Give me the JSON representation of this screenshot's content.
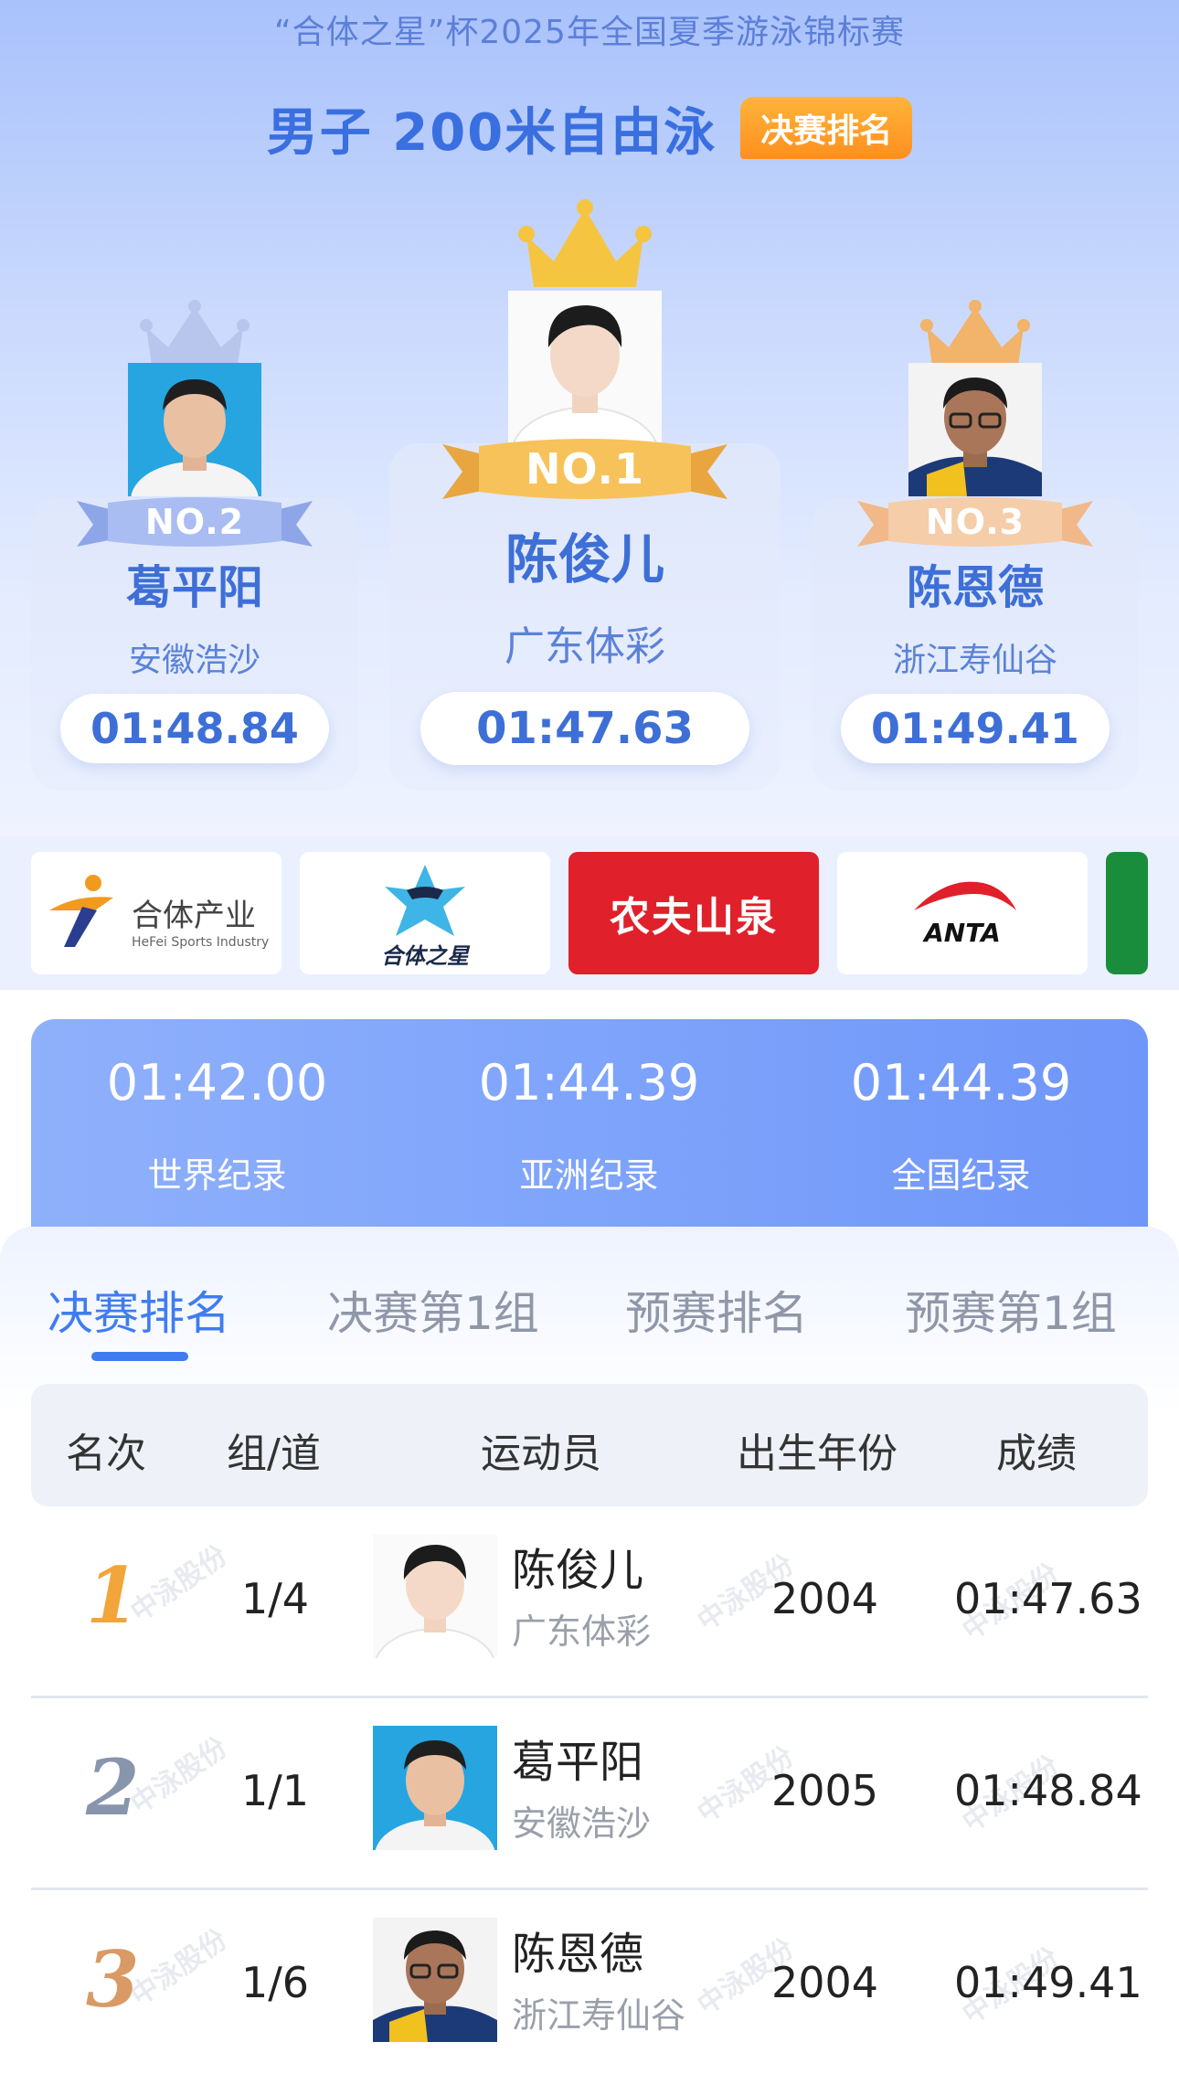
{
  "header": {
    "event_title": "“合体之星”杯2025年全国夏季游泳锦标赛",
    "race_title": "男子 200米自由泳",
    "race_badge": "决赛排名"
  },
  "podium": [
    {
      "position": "first",
      "rank_label": "NO.1",
      "name": "陈俊儿",
      "team": "广东体彩",
      "time": "01:47.63",
      "crown_color": "#f5c542"
    },
    {
      "position": "second",
      "rank_label": "NO.2",
      "name": "葛平阳",
      "team": "安徽浩沙",
      "time": "01:48.84",
      "crown_color": "#b8c6ee"
    },
    {
      "position": "third",
      "rank_label": "NO.3",
      "name": "陈恩德",
      "team": "浙江寿仙谷",
      "time": "01:49.41",
      "crown_color": "#f2b36a"
    }
  ],
  "sponsors": [
    {
      "name": "合体产业",
      "subtitle": "HeFei Sports Industry"
    },
    {
      "name": "合体之星",
      "subtitle": ""
    },
    {
      "name": "农夫山泉",
      "subtitle": ""
    },
    {
      "name": "ANTA",
      "subtitle": ""
    }
  ],
  "records": [
    {
      "time": "01:42.00",
      "label": "世界纪录"
    },
    {
      "time": "01:44.39",
      "label": "亚洲纪录"
    },
    {
      "time": "01:44.39",
      "label": "全国纪录"
    }
  ],
  "tabs": [
    {
      "label": "决赛排名",
      "active": true
    },
    {
      "label": "决赛第1组",
      "active": false
    },
    {
      "label": "预赛排名",
      "active": false
    },
    {
      "label": "预赛第1组",
      "active": false
    }
  ],
  "table": {
    "headers": [
      "名次",
      "组/道",
      "运动员",
      "出生年份",
      "成绩"
    ],
    "watermark": "中泳股份",
    "rows": [
      {
        "rank": "1",
        "lane": "1/4",
        "name": "陈俊儿",
        "team": "广东体彩",
        "year": "2004",
        "time": "01:47.63",
        "rank_color": "#f2a53a"
      },
      {
        "rank": "2",
        "lane": "1/1",
        "name": "葛平阳",
        "team": "安徽浩沙",
        "year": "2005",
        "time": "01:48.84",
        "rank_color": "#8795ad"
      },
      {
        "rank": "3",
        "lane": "1/6",
        "name": "陈恩德",
        "team": "浙江寿仙谷",
        "year": "2004",
        "time": "01:49.41",
        "rank_color": "#d99a66"
      }
    ]
  },
  "colors": {
    "accent": "#3f7cf0",
    "gold": "#f5c542",
    "silver": "#b8c6ee",
    "bronze": "#f2b36a",
    "orange_badge": "#ff9a24"
  }
}
